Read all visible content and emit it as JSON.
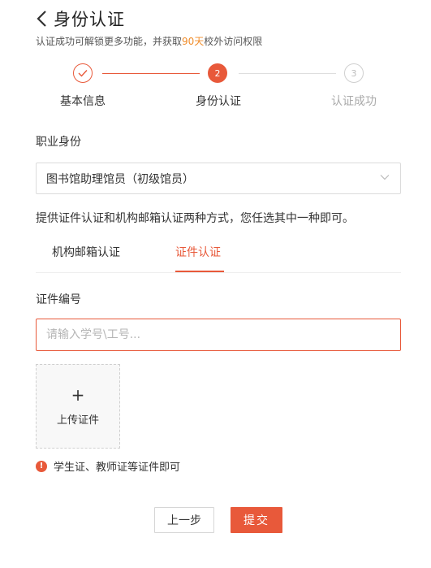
{
  "header": {
    "title": "身份认证",
    "subtitle_prefix": "认证成功可解锁更多功能，并获取",
    "subtitle_highlight": "90天",
    "subtitle_suffix": "校外访问权限"
  },
  "steps": [
    {
      "label": "基本信息",
      "state": "done"
    },
    {
      "label": "身份认证",
      "number": "2",
      "state": "active"
    },
    {
      "label": "认证成功",
      "number": "3",
      "state": "pending"
    }
  ],
  "occupation": {
    "label": "职业身份",
    "selected": "图书馆助理馆员（初级馆员）"
  },
  "description": "提供证件认证和机构邮箱认证两种方式，您任选其中一种即可。",
  "tabs": [
    {
      "label": "机构邮箱认证",
      "active": false
    },
    {
      "label": "证件认证",
      "active": true
    }
  ],
  "id_field": {
    "label": "证件编号",
    "placeholder": "请输入学号\\工号...",
    "value": ""
  },
  "upload": {
    "plus": "+",
    "label": "上传证件"
  },
  "hint": {
    "icon": "!",
    "text": "学生证、教师证等证件即可"
  },
  "buttons": {
    "prev": "上一步",
    "submit": "提交"
  },
  "colors": {
    "accent": "#e8593a",
    "highlight": "#f08c2a",
    "border": "#dcdcdc"
  }
}
